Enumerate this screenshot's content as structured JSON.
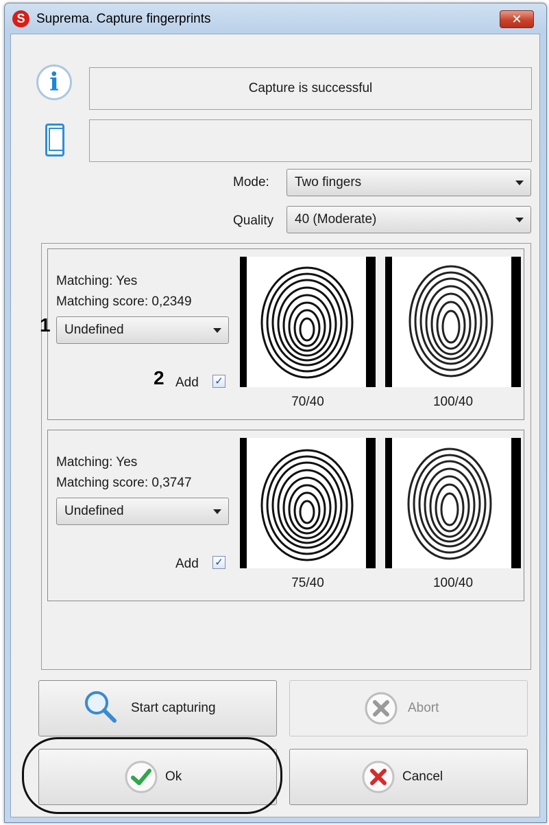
{
  "window": {
    "title": "Suprema. Capture fingerprints",
    "logo_letter": "S",
    "close_glyph": "✕"
  },
  "status": {
    "message": "Capture is successful",
    "device_message": ""
  },
  "settings": {
    "mode_label": "Mode:",
    "mode_value": "Two fingers",
    "quality_label": "Quality",
    "quality_value": "40 (Moderate)"
  },
  "fingers": [
    {
      "matching": "Matching: Yes",
      "score": "Matching score: 0,2349",
      "finger_select": "Undefined",
      "add_label": "Add",
      "add_checked": "✓",
      "image_scores": [
        "70/40",
        "100/40"
      ]
    },
    {
      "matching": "Matching: Yes",
      "score": "Matching score: 0,3747",
      "finger_select": "Undefined",
      "add_label": "Add",
      "add_checked": "✓",
      "image_scores": [
        "75/40",
        "100/40"
      ]
    }
  ],
  "annotations": [
    "1",
    "2"
  ],
  "buttons": {
    "start": "Start capturing",
    "abort": "Abort",
    "ok": "Ok",
    "cancel": "Cancel"
  },
  "icons": [
    "s-logo-icon",
    "close-icon",
    "info-icon",
    "device-icon",
    "chevron-down-icon",
    "fingerprint-icon",
    "search-icon",
    "abort-icon",
    "check-icon",
    "cancel-icon"
  ]
}
